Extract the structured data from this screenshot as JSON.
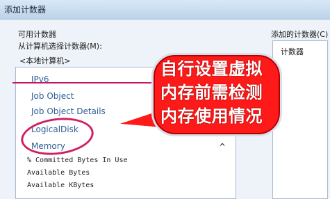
{
  "window": {
    "title": "添加计数器"
  },
  "left": {
    "available_label": "可用计数器",
    "select_from_label": "从计算机选择计数器(M):",
    "machine_value": "<本地计算机>",
    "items": [
      {
        "label": "IPv6"
      },
      {
        "label": "Job Object"
      },
      {
        "label": "Job Object Details"
      },
      {
        "label": "LogicalDisk"
      },
      {
        "label": "Memory"
      }
    ],
    "sub_items": [
      {
        "label": "% Committed Bytes In Use"
      },
      {
        "label": "Available Bytes"
      },
      {
        "label": "Available KBytes"
      }
    ],
    "collapse_label": "^"
  },
  "right": {
    "added_label": "添加的计数器(C)",
    "column_header": "计数器"
  },
  "callout": {
    "line1": "自行设置虚拟",
    "line2": "内存前需检测",
    "line3": "内存使用情况"
  }
}
